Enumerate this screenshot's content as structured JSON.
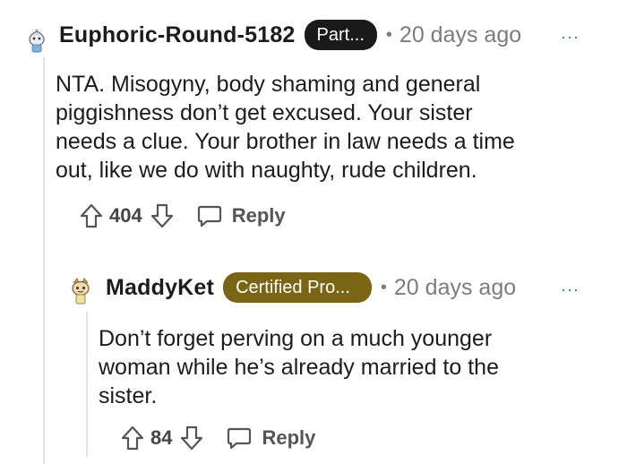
{
  "comments": [
    {
      "username": "Euphoric-Round-5182",
      "flair": "Part...",
      "flair_color": "#1a1a1b",
      "separator": "•",
      "timestamp": "20 days ago",
      "more": "···",
      "text": "NTA. Misogyny, body shaming and general piggishness don’t get excused. Your sister needs a clue. Your brother in law needs a time out, like we do with naughty, rude children.",
      "text_lines": [
        "NTA. Misogyny, body shaming and general",
        "piggishness don’t get excused. Your sister",
        "needs a clue. Your brother in law needs a time",
        "out, like we do with naughty, rude children."
      ],
      "votes": "404",
      "reply_label": "Reply",
      "avatar_icon": "snoo-avatar-icon"
    },
    {
      "username": "MaddyKet",
      "flair": "Certified Pro...",
      "flair_color": "#7a6514",
      "separator": "•",
      "timestamp": "20 days ago",
      "more": "···",
      "text_lines": [
        "Don’t forget perving on a much younger",
        "woman while he’s already married to the",
        "sister."
      ],
      "votes": "84",
      "reply_label": "Reply",
      "avatar_icon": "snoo-avatar-icon"
    }
  ],
  "icons": {
    "upvote": "arrow-up-icon",
    "downvote": "arrow-down-icon",
    "reply": "speech-bubble-icon",
    "more": "ellipsis-icon"
  }
}
